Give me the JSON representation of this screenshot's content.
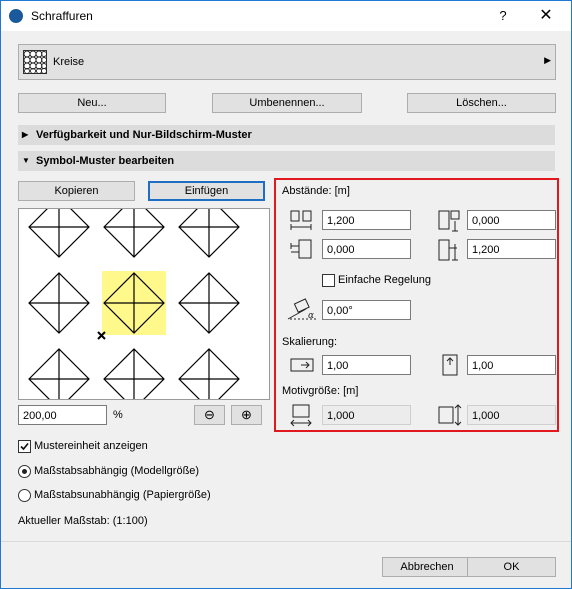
{
  "window": {
    "title": "Schraffuren",
    "help": "?",
    "close": "✕"
  },
  "selector": {
    "value": "Kreise",
    "arrow": "▶"
  },
  "toolbar": {
    "new": "Neu...",
    "rename": "Umbenennen...",
    "delete": "Löschen..."
  },
  "sections": {
    "availability": "Verfügbarkeit und Nur-Bildschirm-Muster",
    "edit_symbol": "Symbol-Muster bearbeiten",
    "collapsed_arrow": "▶",
    "expanded_arrow": "▼"
  },
  "edit": {
    "copy": "Kopieren",
    "paste": "Einfügen"
  },
  "zoom": {
    "value": "200,00",
    "unit": "%",
    "zoom_out": "⊖",
    "zoom_in": "⊕"
  },
  "spacing": {
    "title": "Abstände: [m]",
    "h_spacing": "1,200",
    "v_spacing": "0,000",
    "h_offset": "0,000",
    "v_offset": "1,200",
    "simple_label": "Einfache Regelung",
    "angle": "0,00°"
  },
  "scaling": {
    "title": "Skalierung:",
    "x": "1,00",
    "y": "1,00"
  },
  "motif": {
    "title": "Motivgröße: [m]",
    "width": "1,000",
    "height": "1,000"
  },
  "options": {
    "show_unit": "Mustereinheit anzeigen",
    "scale_dependent": "Maßstabsabhängig (Modellgröße)",
    "scale_independent": "Maßstabsunabhängig (Papiergröße)",
    "current_scale": "Aktueller Maßstab: (1:100)"
  },
  "footer": {
    "cancel": "Abbrechen",
    "ok": "OK"
  },
  "colors": {
    "highlight": "#fff88a",
    "red_frame": "#e1191f",
    "accent": "#1e6ec4"
  }
}
